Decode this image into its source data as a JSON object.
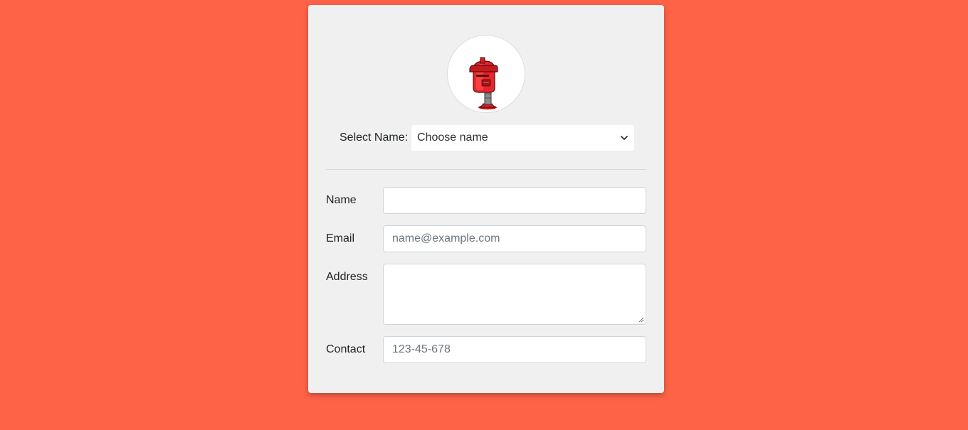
{
  "profile": {
    "avatar_icon": "mailbox-icon",
    "select_label": "Select Name:",
    "select_value": "Choose name"
  },
  "form": {
    "name_label": "Name",
    "name_value": "",
    "email_label": "Email",
    "email_placeholder": "name@example.com",
    "address_label": "Address",
    "address_value": "",
    "contact_label": "Contact",
    "contact_placeholder": "123-45-678"
  },
  "colors": {
    "background": "#ff6347",
    "card": "#f0f0f0",
    "mailbox_red": "#e8262a"
  }
}
